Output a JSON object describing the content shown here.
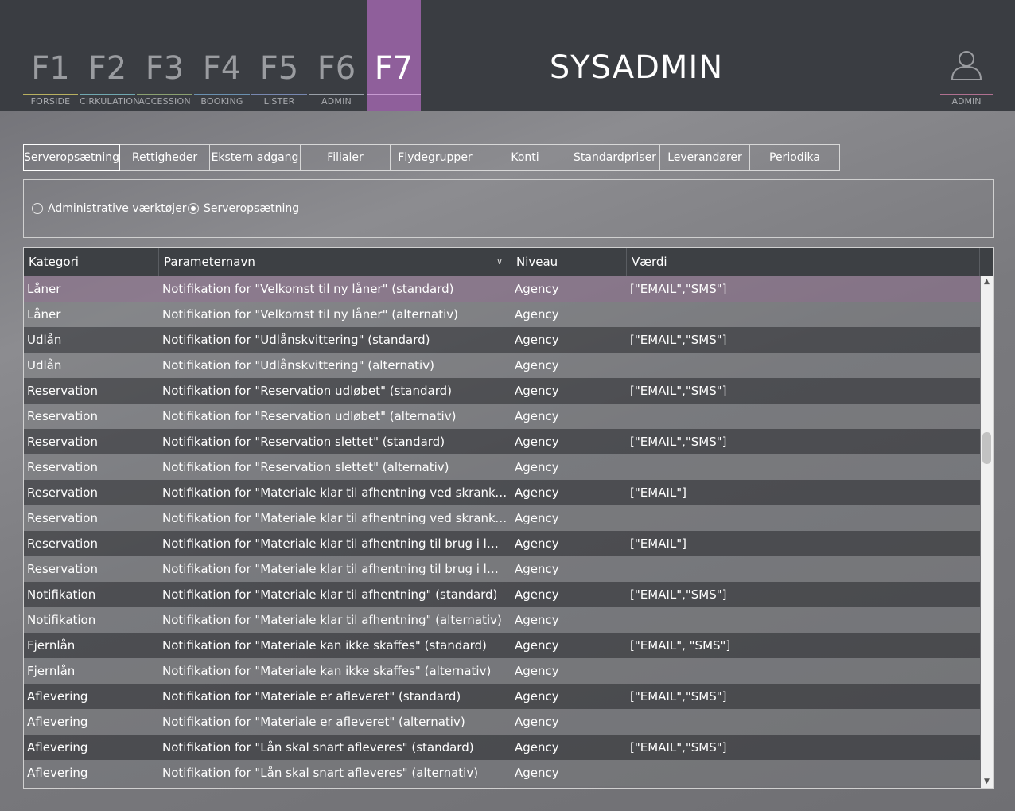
{
  "header": {
    "title": "SYSADMIN",
    "fkeys": [
      {
        "key": "F1",
        "label": "FORSIDE",
        "accent": "#b8b060"
      },
      {
        "key": "F2",
        "label": "CIRKULATION",
        "accent": "#70a8b0"
      },
      {
        "key": "F3",
        "label": "ACCESSION",
        "accent": "#8aa070"
      },
      {
        "key": "F4",
        "label": "BOOKING",
        "accent": "#6a90b0"
      },
      {
        "key": "F5",
        "label": "LISTER",
        "accent": "#7888b0"
      },
      {
        "key": "F6",
        "label": "ADMIN",
        "accent": "#9aa0a8"
      },
      {
        "key": "F7",
        "label": "",
        "accent": "#c79ad1"
      }
    ],
    "user_label": "ADMIN",
    "active_color": "#8f5f9b"
  },
  "tabs": [
    {
      "label": "Serveropsætning",
      "active": true
    },
    {
      "label": "Rettigheder"
    },
    {
      "label": "Ekstern adgang"
    },
    {
      "label": "Filialer"
    },
    {
      "label": "Flydegrupper"
    },
    {
      "label": "Konti"
    },
    {
      "label": "Standardpriser"
    },
    {
      "label": "Leverandører"
    },
    {
      "label": "Periodika"
    }
  ],
  "radios": [
    {
      "label": "Administrative værktøjer",
      "checked": false
    },
    {
      "label": "Serveropsætning",
      "checked": true
    }
  ],
  "grid": {
    "columns": [
      "Kategori",
      "Parameternavn",
      "Niveau",
      "Værdi"
    ],
    "partial_row": {
      "kategori": "",
      "niveau": "Agency"
    },
    "rows": [
      {
        "kategori": "Låner",
        "param": "Notifikation for \"Velkomst til ny låner\" (standard)",
        "niveau": "Agency",
        "vaerdi": "[\"EMAIL\",\"SMS\"]"
      },
      {
        "kategori": "Låner",
        "param": "Notifikation for \"Velkomst til ny låner\" (alternativ)",
        "niveau": "Agency",
        "vaerdi": ""
      },
      {
        "kategori": "Udlån",
        "param": "Notifikation for \"Udlånskvittering\" (standard)",
        "niveau": "Agency",
        "vaerdi": "[\"EMAIL\",\"SMS\"]"
      },
      {
        "kategori": "Udlån",
        "param": "Notifikation for \"Udlånskvittering\" (alternativ)",
        "niveau": "Agency",
        "vaerdi": ""
      },
      {
        "kategori": "Reservation",
        "param": "Notifikation for \"Reservation udløbet\" (standard)",
        "niveau": "Agency",
        "vaerdi": "[\"EMAIL\",\"SMS\"]"
      },
      {
        "kategori": "Reservation",
        "param": "Notifikation for \"Reservation udløbet\" (alternativ)",
        "niveau": "Agency",
        "vaerdi": ""
      },
      {
        "kategori": "Reservation",
        "param": "Notifikation for \"Reservation slettet\" (standard)",
        "niveau": "Agency",
        "vaerdi": "[\"EMAIL\",\"SMS\"]"
      },
      {
        "kategori": "Reservation",
        "param": "Notifikation for \"Reservation slettet\" (alternativ)",
        "niveau": "Agency",
        "vaerdi": ""
      },
      {
        "kategori": "Reservation",
        "param": "Notifikation for \"Materiale klar til afhentning ved skranke\" (s...",
        "niveau": "Agency",
        "vaerdi": "[\"EMAIL\"]"
      },
      {
        "kategori": "Reservation",
        "param": "Notifikation for \"Materiale klar til afhentning ved skranke\" (a...",
        "niveau": "Agency",
        "vaerdi": ""
      },
      {
        "kategori": "Reservation",
        "param": "Notifikation for \"Materiale klar til afhentning til brug i læses...",
        "niveau": "Agency",
        "vaerdi": "[\"EMAIL\"]"
      },
      {
        "kategori": "Reservation",
        "param": "Notifikation for \"Materiale klar til afhentning til brug i læses...",
        "niveau": "Agency",
        "vaerdi": ""
      },
      {
        "kategori": "Notifikation",
        "param": "Notifikation for \"Materiale klar til afhentning\" (standard)",
        "niveau": "Agency",
        "vaerdi": "[\"EMAIL\",\"SMS\"]"
      },
      {
        "kategori": "Notifikation",
        "param": "Notifikation for \"Materiale klar til afhentning\" (alternativ)",
        "niveau": "Agency",
        "vaerdi": ""
      },
      {
        "kategori": "Fjernlån",
        "param": "Notifikation for \"Materiale kan ikke skaffes\" (standard)",
        "niveau": "Agency",
        "vaerdi": "[\"EMAIL\", \"SMS\"]"
      },
      {
        "kategori": "Fjernlån",
        "param": "Notifikation for \"Materiale kan ikke skaffes\" (alternativ)",
        "niveau": "Agency",
        "vaerdi": ""
      },
      {
        "kategori": "Aflevering",
        "param": "Notifikation for \"Materiale er afleveret\" (standard)",
        "niveau": "Agency",
        "vaerdi": "[\"EMAIL\",\"SMS\"]"
      },
      {
        "kategori": "Aflevering",
        "param": "Notifikation for \"Materiale er afleveret\" (alternativ)",
        "niveau": "Agency",
        "vaerdi": ""
      },
      {
        "kategori": "Aflevering",
        "param": "Notifikation for \"Lån skal snart afleveres\" (standard)",
        "niveau": "Agency",
        "vaerdi": "[\"EMAIL\",\"SMS\"]"
      },
      {
        "kategori": "Aflevering",
        "param": "Notifikation for \"Lån skal snart afleveres\" (alternativ)",
        "niveau": "Agency",
        "vaerdi": ""
      }
    ],
    "selected_row": 0,
    "scroll_position": 0.32
  }
}
